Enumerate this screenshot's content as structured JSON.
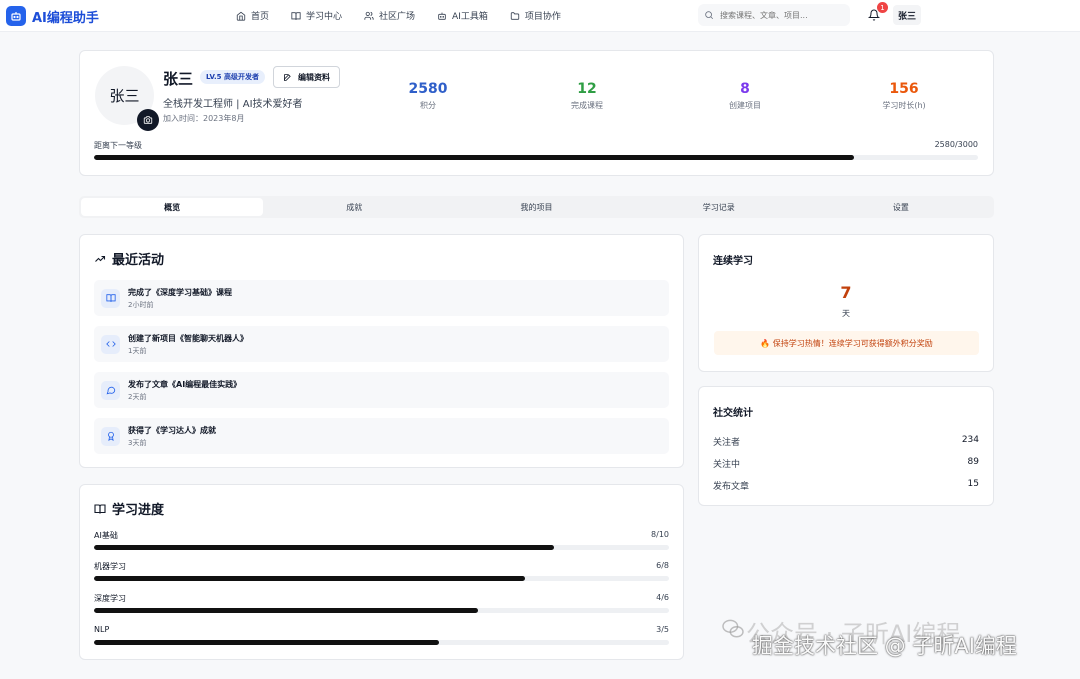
{
  "brand": {
    "name": "AI编程助手",
    "color": "#2563eb"
  },
  "nav": {
    "items": [
      {
        "label": "首页",
        "icon": "home-icon"
      },
      {
        "label": "学习中心",
        "icon": "book-open-icon"
      },
      {
        "label": "社区广场",
        "icon": "users-icon"
      },
      {
        "label": "AI工具箱",
        "icon": "bot-icon"
      },
      {
        "label": "项目协作",
        "icon": "folder-icon"
      }
    ],
    "search_placeholder": "搜索课程、文章、项目...",
    "notification_count": "1",
    "user": "张三"
  },
  "profile": {
    "avatar_text": "张三",
    "name": "张三",
    "level": "LV.5 高级开发者",
    "edit_label": "编辑资料",
    "title": "全栈开发工程师 | AI技术爱好者",
    "joined": "加入时间：2023年8月",
    "stats": [
      {
        "value": "2580",
        "label": "积分",
        "color": "#2f5fc9"
      },
      {
        "value": "12",
        "label": "完成课程",
        "color": "#2f9e44"
      },
      {
        "value": "8",
        "label": "创建项目",
        "color": "#7c3aed"
      },
      {
        "value": "156",
        "label": "学习时长(h)",
        "color": "#ea580c"
      }
    ],
    "next_level_label": "距离下一等级",
    "next_level_value": "2580/3000",
    "next_level_progress": 0.86
  },
  "tabs": [
    {
      "label": "概览",
      "active": true
    },
    {
      "label": "成就",
      "active": false
    },
    {
      "label": "我的项目",
      "active": false
    },
    {
      "label": "学习记录",
      "active": false
    },
    {
      "label": "设置",
      "active": false
    }
  ],
  "activity": {
    "title": "最近活动",
    "items": [
      {
        "text": "完成了《深度学习基础》课程",
        "time": "2小时前",
        "icon": "book-icon"
      },
      {
        "text": "创建了新项目《智能聊天机器人》",
        "time": "1天前",
        "icon": "code-icon"
      },
      {
        "text": "发布了文章《AI编程最佳实践》",
        "time": "2天前",
        "icon": "message-icon"
      },
      {
        "text": "获得了《学习达人》成就",
        "time": "3天前",
        "icon": "award-icon"
      }
    ]
  },
  "learning": {
    "title": "学习进度",
    "items": [
      {
        "name": "AI基础",
        "value": "8/10",
        "progress": 0.8
      },
      {
        "name": "机器学习",
        "value": "6/8",
        "progress": 0.75
      },
      {
        "name": "深度学习",
        "value": "4/6",
        "progress": 0.667
      },
      {
        "name": "NLP",
        "value": "3/5",
        "progress": 0.6
      }
    ]
  },
  "streak": {
    "title": "连续学习",
    "days": "7",
    "unit": "天",
    "tip": "🔥 保持学习热情！连续学习可获得额外积分奖励"
  },
  "social": {
    "title": "社交统计",
    "rows": [
      {
        "label": "关注者",
        "value": "234"
      },
      {
        "label": "关注中",
        "value": "89"
      },
      {
        "label": "发布文章",
        "value": "15"
      }
    ]
  },
  "watermark": {
    "line1": "公众号 · 子昕AI编程",
    "line2": "掘金技术社区 @ 子昕AI编程"
  }
}
